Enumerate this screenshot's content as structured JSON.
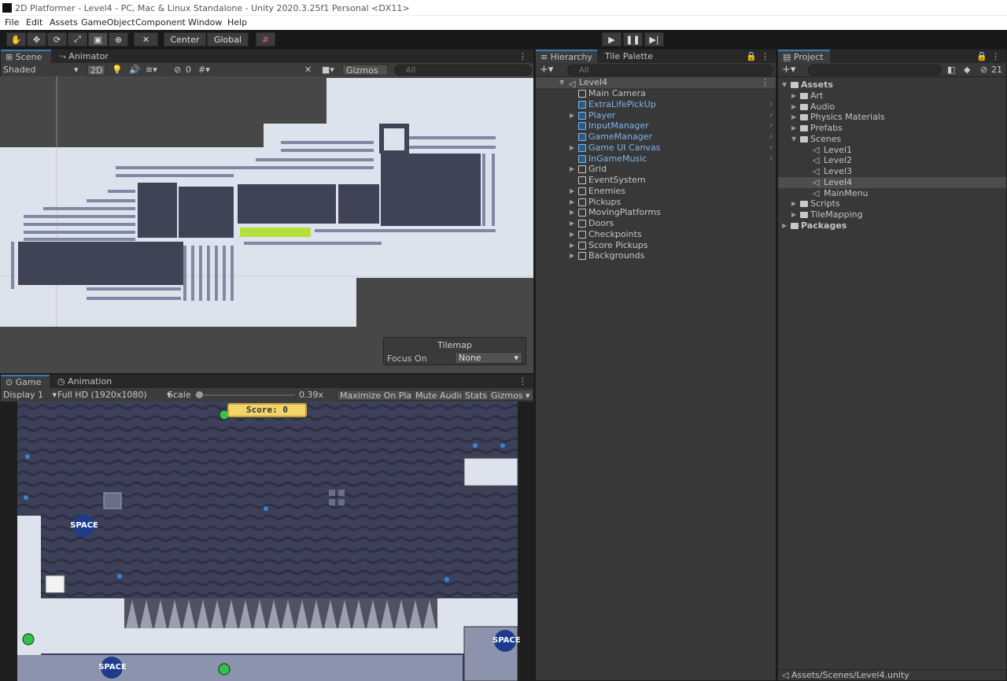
{
  "window": {
    "title": "2D Platformer - Level4 - PC, Mac & Linux Standalone - Unity 2020.3.25f1 Personal <DX11>"
  },
  "menu": [
    "File",
    "Edit",
    "Assets",
    "GameObject",
    "Component",
    "Window",
    "Help"
  ],
  "toolbar": {
    "center_label": "Center",
    "global_label": "Global"
  },
  "scene_panel": {
    "tabs": [
      "Scene",
      "Animator"
    ],
    "shading": "Shaded",
    "mode_2d": "2D",
    "hidden_count": "0",
    "gizmos": "Gizmos",
    "search_placeholder": "All",
    "tilemap": {
      "title": "Tilemap",
      "focus_label": "Focus On",
      "focus_value": "None"
    }
  },
  "game_panel": {
    "tabs": [
      "Game",
      "Animation"
    ],
    "display": "Display 1",
    "resolution": "Full HD (1920x1080)",
    "scale_label": "Scale",
    "scale_value": "0.39x",
    "scale_fraction": 0.05,
    "maximize": "Maximize On Play",
    "mute": "Mute Audio",
    "stats": "Stats",
    "gizmos": "Gizmos",
    "score_text": "Score: 0",
    "logo_text": "SPACE"
  },
  "hierarchy": {
    "tabs": [
      "Hierarchy",
      "Tile Palette"
    ],
    "search_placeholder": "All",
    "scene_name": "Level4",
    "items": [
      {
        "label": "Main Camera",
        "prefab": false,
        "expandable": false,
        "chevron": false
      },
      {
        "label": "ExtraLifePickUp",
        "prefab": true,
        "expandable": false,
        "chevron": true
      },
      {
        "label": "Player",
        "prefab": true,
        "expandable": true,
        "chevron": true
      },
      {
        "label": "InputManager",
        "prefab": true,
        "expandable": false,
        "chevron": true
      },
      {
        "label": "GameManager",
        "prefab": true,
        "expandable": false,
        "chevron": true
      },
      {
        "label": "Game UI Canvas",
        "prefab": true,
        "expandable": true,
        "chevron": true
      },
      {
        "label": "InGameMusic",
        "prefab": true,
        "expandable": false,
        "chevron": true
      },
      {
        "label": "Grid",
        "prefab": false,
        "expandable": true,
        "chevron": false
      },
      {
        "label": "EventSystem",
        "prefab": false,
        "expandable": false,
        "chevron": false
      },
      {
        "label": "Enemies",
        "prefab": false,
        "expandable": true,
        "chevron": false
      },
      {
        "label": "Pickups",
        "prefab": false,
        "expandable": true,
        "chevron": false
      },
      {
        "label": "MovingPlatforms",
        "prefab": false,
        "expandable": true,
        "chevron": false
      },
      {
        "label": "Doors",
        "prefab": false,
        "expandable": true,
        "chevron": false
      },
      {
        "label": "Checkpoints",
        "prefab": false,
        "expandable": true,
        "chevron": false
      },
      {
        "label": "Score Pickups",
        "prefab": false,
        "expandable": true,
        "chevron": false
      },
      {
        "label": "Backgrounds",
        "prefab": false,
        "expandable": true,
        "chevron": false
      }
    ]
  },
  "project": {
    "tab": "Project",
    "hidden_count": "21",
    "tree": [
      {
        "label": "Assets",
        "level": 0,
        "type": "folder",
        "expanded": true,
        "bold": true
      },
      {
        "label": "Art",
        "level": 1,
        "type": "folder",
        "expanded": false,
        "bold": false
      },
      {
        "label": "Audio",
        "level": 1,
        "type": "folder",
        "expanded": false,
        "bold": false
      },
      {
        "label": "Physics Materials",
        "level": 1,
        "type": "folder",
        "expanded": false,
        "bold": false
      },
      {
        "label": "Prefabs",
        "level": 1,
        "type": "folder",
        "expanded": false,
        "bold": false
      },
      {
        "label": "Scenes",
        "level": 1,
        "type": "folder",
        "expanded": true,
        "bold": false
      },
      {
        "label": "Level1",
        "level": 2,
        "type": "scene",
        "bold": false
      },
      {
        "label": "Level2",
        "level": 2,
        "type": "scene",
        "bold": false
      },
      {
        "label": "Level3",
        "level": 2,
        "type": "scene",
        "bold": false
      },
      {
        "label": "Level4",
        "level": 2,
        "type": "scene",
        "bold": false,
        "selected": true
      },
      {
        "label": "MainMenu",
        "level": 2,
        "type": "scene",
        "bold": false
      },
      {
        "label": "Scripts",
        "level": 1,
        "type": "folder",
        "expanded": false,
        "bold": false
      },
      {
        "label": "TileMapping",
        "level": 1,
        "type": "folder",
        "expanded": false,
        "bold": false
      },
      {
        "label": "Packages",
        "level": 0,
        "type": "folder",
        "expanded": false,
        "bold": true
      }
    ],
    "footer_path": "Assets/Scenes/Level4.unity"
  },
  "colors": {
    "accent": "#3a79bb",
    "prefab_blue": "#7cb5ee",
    "panel_bg": "#383838",
    "selected_row": "#4d4d4d",
    "score_bg": "#f3d56a"
  }
}
